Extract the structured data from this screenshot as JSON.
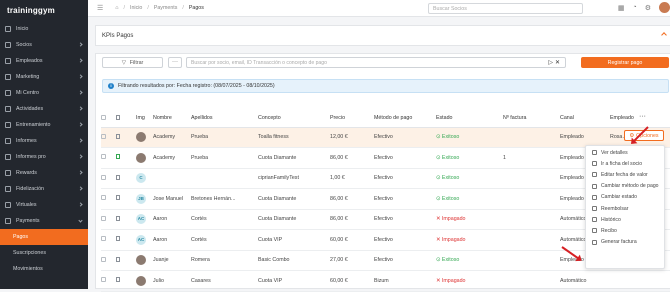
{
  "app": {
    "logo": "traininggym"
  },
  "sidebar": {
    "items": [
      {
        "label": "Inicio",
        "chevron": false,
        "icon": "home-icon"
      },
      {
        "label": "Socios",
        "chevron": true,
        "icon": "users-icon"
      },
      {
        "label": "Empleados",
        "chevron": true,
        "icon": "employee-icon"
      },
      {
        "label": "Marketing",
        "chevron": true,
        "icon": "marketing-icon"
      },
      {
        "label": "Mi Centro",
        "chevron": true,
        "icon": "building-icon"
      },
      {
        "label": "Actividades",
        "chevron": true,
        "icon": "calendar-icon"
      },
      {
        "label": "Entrenamiento",
        "chevron": true,
        "icon": "dumbbell-icon"
      },
      {
        "label": "Informes",
        "chevron": true,
        "icon": "report-icon"
      },
      {
        "label": "Informes pro",
        "chevron": true,
        "icon": "report-pro-icon"
      },
      {
        "label": "Rewards",
        "chevron": true,
        "icon": "gift-icon"
      },
      {
        "label": "Fidelización",
        "chevron": true,
        "icon": "heart-icon"
      },
      {
        "label": "Virtuales",
        "chevron": true,
        "icon": "video-icon"
      },
      {
        "label": "Payments",
        "chevron": true,
        "icon": "payments-icon",
        "open": true
      }
    ],
    "sub_items": [
      {
        "label": "Pagos",
        "active": true
      },
      {
        "label": "Suscripciones",
        "active": false
      },
      {
        "label": "Movimientos",
        "active": false
      }
    ]
  },
  "topbar": {
    "breadcrumb": [
      "Inicio",
      "Payments",
      "Pagos"
    ],
    "search_placeholder": "Buscar Socios"
  },
  "kpi": {
    "title": "KPIs Pagos"
  },
  "toolbar": {
    "filter_label": "Filtrar",
    "more_label": "···",
    "search_placeholder": "Buscar por socio, email, ID Transacción o concepto de pago",
    "register_label": "Registrar pago"
  },
  "info": {
    "text": "Filtrando resultados por: Fecha registro: (08/07/2025 - 08/10/2025)"
  },
  "table": {
    "headers": [
      "",
      "",
      "Img",
      "Nombre",
      "Apellidos",
      "Concepto",
      "Precio",
      "Método de pago",
      "Estado",
      "Nº factura",
      "Canal",
      "Empleado"
    ],
    "rows": [
      {
        "avatar": "photo",
        "nombre": "Academy",
        "apellidos": "Prueba",
        "concepto": "Toalla fitness",
        "precio": "12,00 €",
        "metodo": "Efectivo",
        "estado": "Exitoso",
        "estado_ok": true,
        "factura": "",
        "canal": "Empleado",
        "empleado": "Rosa Acade",
        "highlight": true
      },
      {
        "avatar": "photo",
        "nombre": "Academy",
        "apellidos": "Prueba",
        "concepto": "Cuota Diamante",
        "precio": "86,00 €",
        "metodo": "Efectivo",
        "estado": "Exitoso",
        "estado_ok": true,
        "factura": "1",
        "canal": "Empleado",
        "empleado": ""
      },
      {
        "avatar": "C",
        "nombre": "",
        "apellidos": "",
        "concepto": "ciprianFamilyTest",
        "precio": "1,00 €",
        "metodo": "Efectivo",
        "estado": "Exitoso",
        "estado_ok": true,
        "factura": "",
        "canal": "Empleado",
        "empleado": ""
      },
      {
        "avatar": "JB",
        "nombre": "Jose Manuel",
        "apellidos": "Bretones Hernán...",
        "concepto": "Cuota Diamante",
        "precio": "86,00 €",
        "metodo": "Efectivo",
        "estado": "Exitoso",
        "estado_ok": true,
        "factura": "",
        "canal": "Empleado",
        "empleado": ""
      },
      {
        "avatar": "AC",
        "nombre": "Aaron",
        "apellidos": "Cortés",
        "concepto": "Cuota Diamante",
        "precio": "86,00 €",
        "metodo": "Efectivo",
        "estado": "Impagado",
        "estado_ok": false,
        "factura": "",
        "canal": "Automático",
        "empleado": ""
      },
      {
        "avatar": "AC",
        "nombre": "Aaron",
        "apellidos": "Cortés",
        "concepto": "Cuota VIP",
        "precio": "60,00 €",
        "metodo": "Efectivo",
        "estado": "Impagado",
        "estado_ok": false,
        "factura": "",
        "canal": "Automático",
        "empleado": ""
      },
      {
        "avatar": "photo",
        "nombre": "Juanje",
        "apellidos": "Romera",
        "concepto": "Basic Combo",
        "precio": "27,00 €",
        "metodo": "Efectivo",
        "estado": "Exitoso",
        "estado_ok": true,
        "factura": "",
        "canal": "Empleado",
        "empleado": ""
      },
      {
        "avatar": "photo",
        "nombre": "Julio",
        "apellidos": "Casares",
        "concepto": "Cuota VIP",
        "precio": "60,00 €",
        "metodo": "Bizum",
        "estado": "Impagado",
        "estado_ok": false,
        "factura": "",
        "canal": "Automático",
        "empleado": ""
      }
    ]
  },
  "options": {
    "dots": "···",
    "button_label": "Opciones"
  },
  "menu": {
    "items": [
      "Ver detalles",
      "Ir a ficha del socio",
      "Editar fecha de valor",
      "Cambiar método de pago",
      "Cambiar estado",
      "Reembolsar",
      "Histórico",
      "Recibo",
      "Generar factura"
    ]
  },
  "colors": {
    "accent": "#f26c1f",
    "sidebar": "#23272e",
    "success": "#35a853",
    "danger": "#dd3333",
    "info_bg": "#e6f2fb",
    "arrow": "#d62024"
  }
}
